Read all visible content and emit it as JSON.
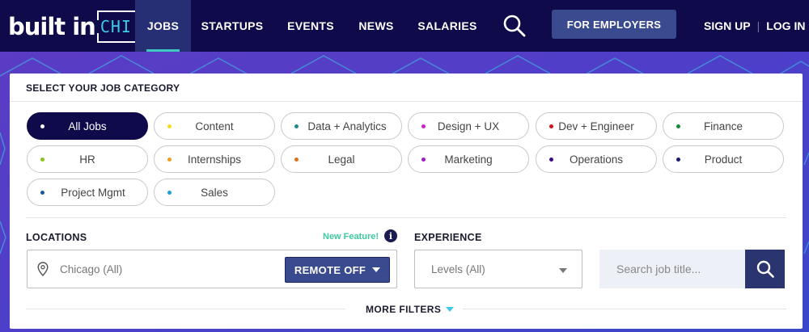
{
  "brand": {
    "name": "built in",
    "city": "CHI"
  },
  "nav": {
    "items": [
      {
        "label": "JOBS",
        "active": true
      },
      {
        "label": "STARTUPS"
      },
      {
        "label": "EVENTS"
      },
      {
        "label": "NEWS"
      },
      {
        "label": "SALARIES"
      }
    ],
    "search_icon": "search-icon",
    "employers_label": "FOR EMPLOYERS",
    "sign_up": "SIGN UP",
    "log_in": "LOG IN"
  },
  "colors": {
    "nav_bg": "#0f0b4a",
    "accent_teal": "#3ec9c0",
    "button_blue": "#3a4a8e",
    "background_purple": "#5a3fc7"
  },
  "category": {
    "title": "SELECT YOUR JOB CATEGORY",
    "pills": [
      {
        "label": "All Jobs",
        "dot": "#ffffff",
        "active": true
      },
      {
        "label": "Content",
        "dot": "#f2df1c"
      },
      {
        "label": "Data + Analytics",
        "dot": "#1a8a8a"
      },
      {
        "label": "Design + UX",
        "dot": "#d41cc9"
      },
      {
        "label": "Dev + Engineer",
        "dot": "#d4111c"
      },
      {
        "label": "Finance",
        "dot": "#1a8a3a"
      },
      {
        "label": "HR",
        "dot": "#8cc21c"
      },
      {
        "label": "Internships",
        "dot": "#f2a01c"
      },
      {
        "label": "Legal",
        "dot": "#e0701c"
      },
      {
        "label": "Marketing",
        "dot": "#a01cc9"
      },
      {
        "label": "Operations",
        "dot": "#3a0a8a"
      },
      {
        "label": "Product",
        "dot": "#1a1a6e"
      },
      {
        "label": "Project Mgmt",
        "dot": "#1a5a9a"
      },
      {
        "label": "Sales",
        "dot": "#1ca0d4"
      }
    ]
  },
  "locations": {
    "label": "LOCATIONS",
    "new_feature": "New Feature!",
    "info_glyph": "i",
    "placeholder": "Chicago (All)",
    "remote_label": "REMOTE OFF"
  },
  "experience": {
    "label": "EXPERIENCE",
    "value": "Levels (All)"
  },
  "search": {
    "placeholder": "Search job title..."
  },
  "more_filters": "MORE FILTERS"
}
